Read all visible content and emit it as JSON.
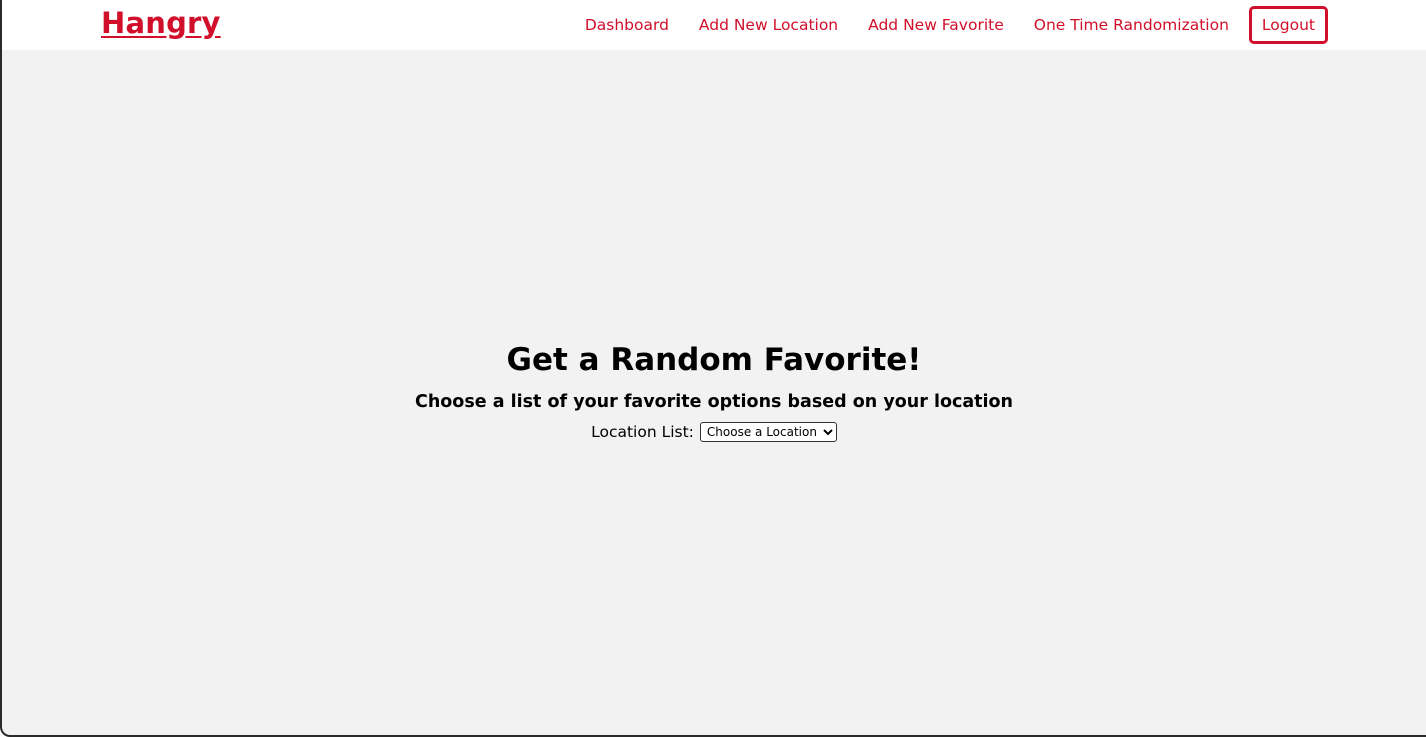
{
  "brand": {
    "name": "Hangry"
  },
  "nav": {
    "links": [
      {
        "label": "Dashboard"
      },
      {
        "label": "Add New Location"
      },
      {
        "label": "Add New Favorite"
      },
      {
        "label": "One Time Randomization"
      }
    ],
    "logout_label": "Logout"
  },
  "main": {
    "title": "Get a Random Favorite!",
    "subtitle": "Choose a list of your favorite options based on your location",
    "location_label": "Location List:",
    "location_select": {
      "selected": "Choose a Location",
      "options": [
        "Choose a Location"
      ]
    }
  },
  "colors": {
    "accent": "#d10f2a",
    "background": "#f2f2f2",
    "navbar": "#ffffff"
  }
}
